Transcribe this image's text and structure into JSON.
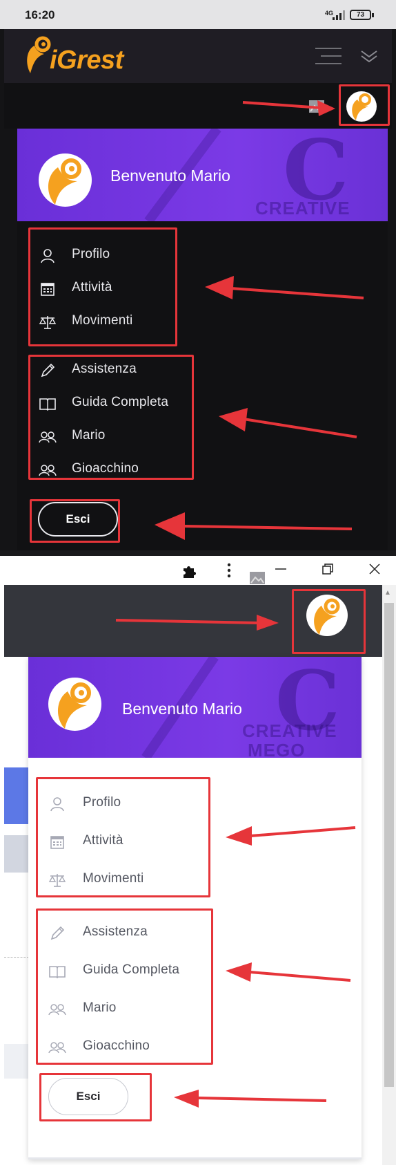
{
  "mobile": {
    "status_bar": {
      "time": "16:20",
      "network": "4G",
      "battery": "73"
    },
    "app_name": "iGrest",
    "welcome": "Benvenuto Mario",
    "hero_big_letter": "C",
    "hero_word": "CREATIVE",
    "menu_group_1": [
      {
        "label": "Profilo",
        "icon": "user-icon"
      },
      {
        "label": "Attività",
        "icon": "calendar-icon"
      },
      {
        "label": "Movimenti",
        "icon": "scale-icon"
      }
    ],
    "menu_group_2": [
      {
        "label": "Assistenza",
        "icon": "pencil-icon"
      },
      {
        "label": "Guida Completa",
        "icon": "book-icon"
      },
      {
        "label": "Mario",
        "icon": "users-icon"
      },
      {
        "label": "Gioacchino",
        "icon": "users-icon"
      }
    ],
    "logout_label": "Esci"
  },
  "desktop": {
    "welcome": "Benvenuto Mario",
    "hero_big_letter": "C",
    "hero_word": "CREATIVE",
    "hero_word_2": "MEGO",
    "menu_group_1": [
      {
        "label": "Profilo",
        "icon": "user-icon"
      },
      {
        "label": "Attività",
        "icon": "calendar-icon"
      },
      {
        "label": "Movimenti",
        "icon": "scale-icon"
      }
    ],
    "menu_group_2": [
      {
        "label": "Assistenza",
        "icon": "pencil-icon"
      },
      {
        "label": "Guida Completa",
        "icon": "book-icon"
      },
      {
        "label": "Mario",
        "icon": "users-icon"
      },
      {
        "label": "Gioacchino",
        "icon": "users-icon"
      }
    ],
    "logout_label": "Esci"
  },
  "colors": {
    "brand_orange": "#f5a11f",
    "hero_purple": "#7b3ae6",
    "highlight_red": "#e6353a",
    "dark_bg": "#141416",
    "desktop_header": "#34363c"
  }
}
